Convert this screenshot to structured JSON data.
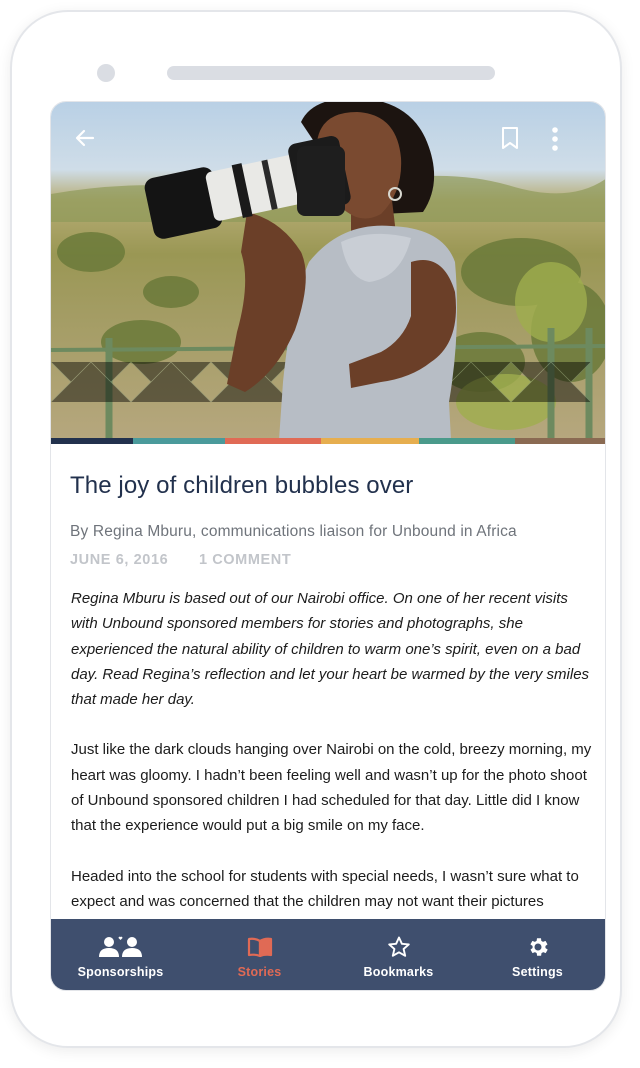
{
  "header": {
    "back_icon": "arrow-left-icon",
    "bookmark_icon": "bookmark-outline-icon",
    "more_icon": "more-vertical-icon"
  },
  "hero": {
    "stripe_colors": [
      "#22314d",
      "#4a9a9b",
      "#e06a55",
      "#e6ae4f",
      "#4a9a8b",
      "#8a6a52"
    ]
  },
  "article": {
    "title": "The joy of children bubbles over",
    "byline": "By Regina Mburu, communications liaison for Unbound in Africa",
    "date": "JUNE 6, 2016",
    "comments": "1 COMMENT",
    "intro": "Regina Mburu is based out of our Nairobi office. On one of her recent visits with Unbound sponsored members for stories and photographs, she experienced the natural ability of children to warm one’s spirit, even on a bad day. Read Regina’s reflection and let your heart be warmed by the very smiles that made her day.",
    "paragraph1": "Just like the dark clouds hanging over Nairobi on the cold, breezy morning, my heart was gloomy. I hadn’t been feeling well and wasn’t up for the photo shoot of Unbound sponsored children I had scheduled for that day. Little did I know that the experience would put a big smile on my face.",
    "paragraph2": "Headed into the school for students with special needs, I wasn’t sure what to expect and was concerned that the children may not want their pictures"
  },
  "tabbar": {
    "items": [
      {
        "label": "Sponsorships",
        "icon": "people-icon",
        "active": false
      },
      {
        "label": "Stories",
        "icon": "book-icon",
        "active": true
      },
      {
        "label": "Bookmarks",
        "icon": "star-icon",
        "active": false
      },
      {
        "label": "Settings",
        "icon": "gear-icon",
        "active": false
      }
    ],
    "active_color": "#e06a55",
    "background": "#3f4f6e"
  }
}
